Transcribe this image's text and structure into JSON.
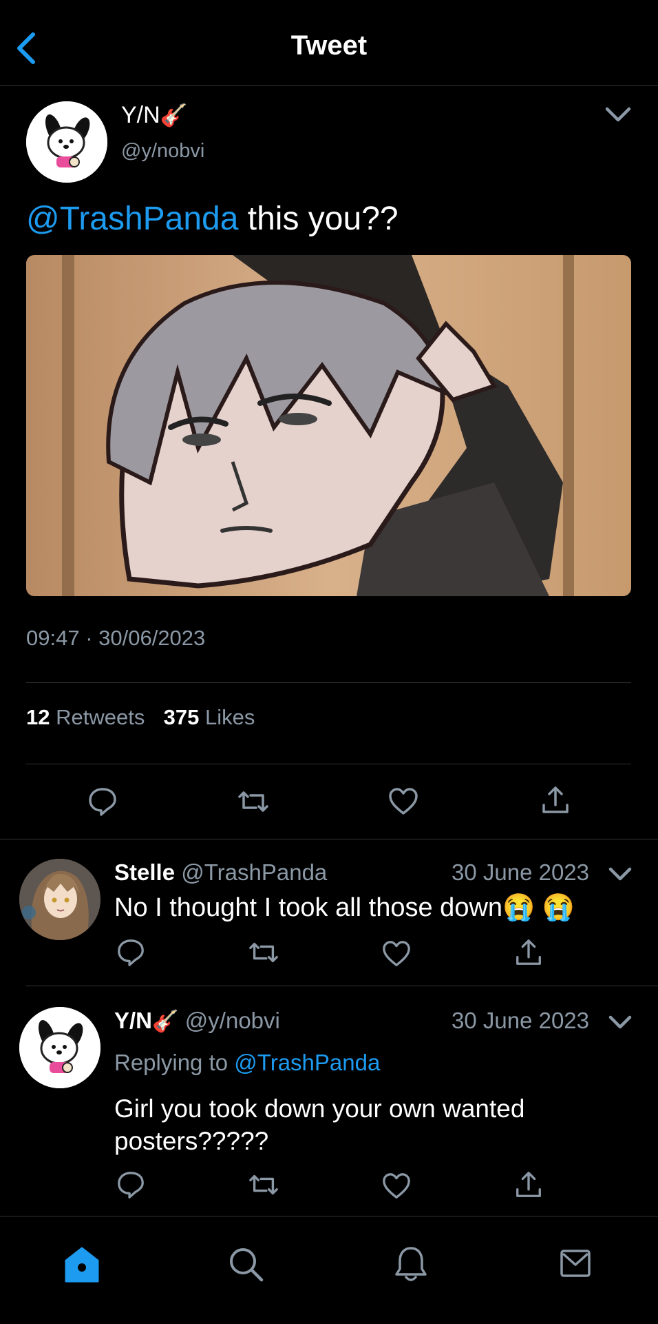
{
  "header": {
    "title": "Tweet"
  },
  "main_tweet": {
    "display_name": "Y/N",
    "name_emoji": "🎸",
    "handle": "@y/nobvi",
    "mention": "@TrashPanda",
    "text": " this you??",
    "timestamp": "09:47 · 30/06/2023",
    "retweets_count": "12",
    "retweets_label": "Retweets",
    "likes_count": "375",
    "likes_label": "Likes"
  },
  "replies": [
    {
      "display_name": "Stelle",
      "handle": "@TrashPanda",
      "date": "30 June 2023",
      "text": "No I thought I took all those down😭 😭"
    },
    {
      "display_name": "Y/N",
      "name_emoji": "🎸",
      "handle": "@y/nobvi",
      "date": "30 June 2023",
      "replying_prefix": "Replying to ",
      "replying_handle": "@TrashPanda",
      "text": "Girl you took down your own wanted posters?????"
    }
  ],
  "colors": {
    "accent": "#1d9bf0",
    "secondary_text": "#8b98a5",
    "divider": "#2f3336",
    "background": "#000000"
  },
  "icons": [
    "back-chevron-icon",
    "chevron-down-icon",
    "reply-icon",
    "retweet-icon",
    "like-icon",
    "share-icon",
    "home-icon",
    "search-icon",
    "notifications-icon",
    "messages-icon"
  ]
}
